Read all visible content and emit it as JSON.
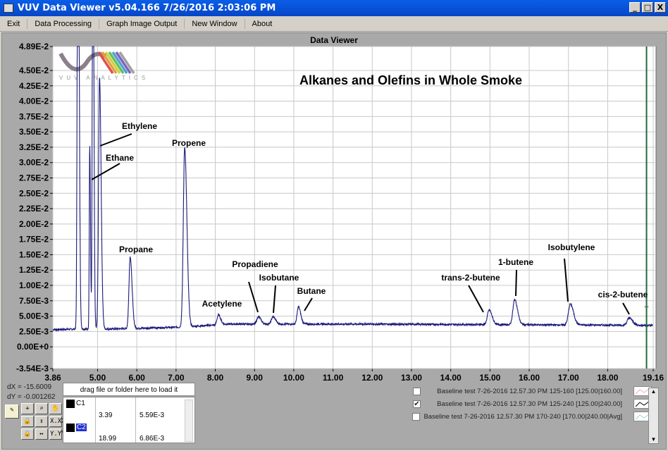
{
  "window": {
    "title": "VUV Data Viewer v5.04.166 7/26/2016 2:03:06 PM",
    "buttons": [
      "_",
      "□",
      "X"
    ]
  },
  "menu": [
    "Exit",
    "Data Processing",
    "Graph Image Output",
    "New Window",
    "About"
  ],
  "panel_title": "Data Viewer",
  "logo": {
    "text": "VUV ANALYTICS"
  },
  "chart_data": {
    "type": "line",
    "title": "Alkanes and Olefins in Whole Smoke",
    "xlim": [
      3.86,
      19.16
    ],
    "ylim": [
      -0.00354,
      0.0489
    ],
    "x_ticks": [
      "3.86",
      "5.00",
      "6.00",
      "7.00",
      "8.00",
      "9.00",
      "10.00",
      "11.00",
      "12.00",
      "13.00",
      "14.00",
      "15.00",
      "16.00",
      "17.00",
      "18.00",
      "19.16"
    ],
    "y_ticks": [
      "4.89E-2",
      "4.50E-2",
      "4.25E-2",
      "4.00E-2",
      "3.75E-2",
      "3.50E-2",
      "3.25E-2",
      "3.00E-2",
      "2.75E-2",
      "2.50E-2",
      "2.25E-2",
      "2.00E-2",
      "1.75E-2",
      "1.50E-2",
      "1.25E-2",
      "1.00E-2",
      "7.50E-3",
      "5.00E-3",
      "2.50E-3",
      "0.00E+0",
      "-3.54E-3"
    ],
    "grid": true,
    "series_color": "#1a1a7a",
    "cursor_color": "#1f6b3a",
    "cursor_x": 18.99,
    "baseline": [
      [
        3.86,
        0.0028
      ],
      [
        4.5,
        0.0029
      ],
      [
        5.3,
        0.0029
      ],
      [
        7.1,
        0.0032
      ],
      [
        7.4,
        0.0033
      ],
      [
        8.3,
        0.0037
      ],
      [
        12,
        0.0037
      ],
      [
        19.16,
        0.0035
      ]
    ],
    "peaks": [
      {
        "x": 4.5,
        "height": 0.09,
        "width": 0.018
      },
      {
        "x": 4.8,
        "height": 0.03,
        "width": 0.012
      },
      {
        "x": 4.88,
        "height": 0.08,
        "width": 0.015
      },
      {
        "x": 5.05,
        "height": 0.041,
        "width": 0.025
      },
      {
        "x": 5.83,
        "height": 0.0117,
        "width": 0.03
      },
      {
        "x": 7.22,
        "height": 0.0293,
        "width": 0.035
      },
      {
        "x": 8.08,
        "height": 0.0016,
        "width": 0.035
      },
      {
        "x": 9.1,
        "height": 0.0012,
        "width": 0.04
      },
      {
        "x": 9.47,
        "height": 0.0012,
        "width": 0.04
      },
      {
        "x": 10.12,
        "height": 0.0028,
        "width": 0.035
      },
      {
        "x": 14.98,
        "height": 0.0024,
        "width": 0.045
      },
      {
        "x": 15.63,
        "height": 0.0041,
        "width": 0.045
      },
      {
        "x": 17.05,
        "height": 0.0034,
        "width": 0.05
      },
      {
        "x": 18.55,
        "height": 0.0012,
        "width": 0.05
      }
    ],
    "annotations": [
      "Ethylene",
      "Ethane",
      "Propene",
      "Propane",
      "Acetylene",
      "Propadiene",
      "Isobutane",
      "Butane",
      "trans-2-butene",
      "1-butene",
      "Isobutylene",
      "cis-2-butene"
    ]
  },
  "cursor_readout": {
    "dx": "dX =   -15.6009",
    "dy": "dY =   -0.001262"
  },
  "tools": {
    "x_format": "X.XX",
    "y_format": "Y.YY"
  },
  "dropzone": "drag file or folder here to load it",
  "cursors": [
    {
      "name": "C1",
      "x": "3.39",
      "y": "5.59E-3"
    },
    {
      "name": "C2",
      "x": "18.99",
      "y": "6.86E-3"
    }
  ],
  "legend": [
    {
      "label": "Baseline test  7-26-2016 12.57.30 PM 125-160 [125.00|160.00]",
      "checked": false,
      "color": "#e8b0b0"
    },
    {
      "label": "Baseline test  7-26-2016 12.57.30 PM 125-240 [125.00|240.00]",
      "checked": true,
      "color": "#000000"
    },
    {
      "label": "Baseline test  7-26-2016 12.57.30 PM 170-240 [170.00|240.00|Avg]",
      "checked": false,
      "color": "#a0d0e0"
    }
  ]
}
